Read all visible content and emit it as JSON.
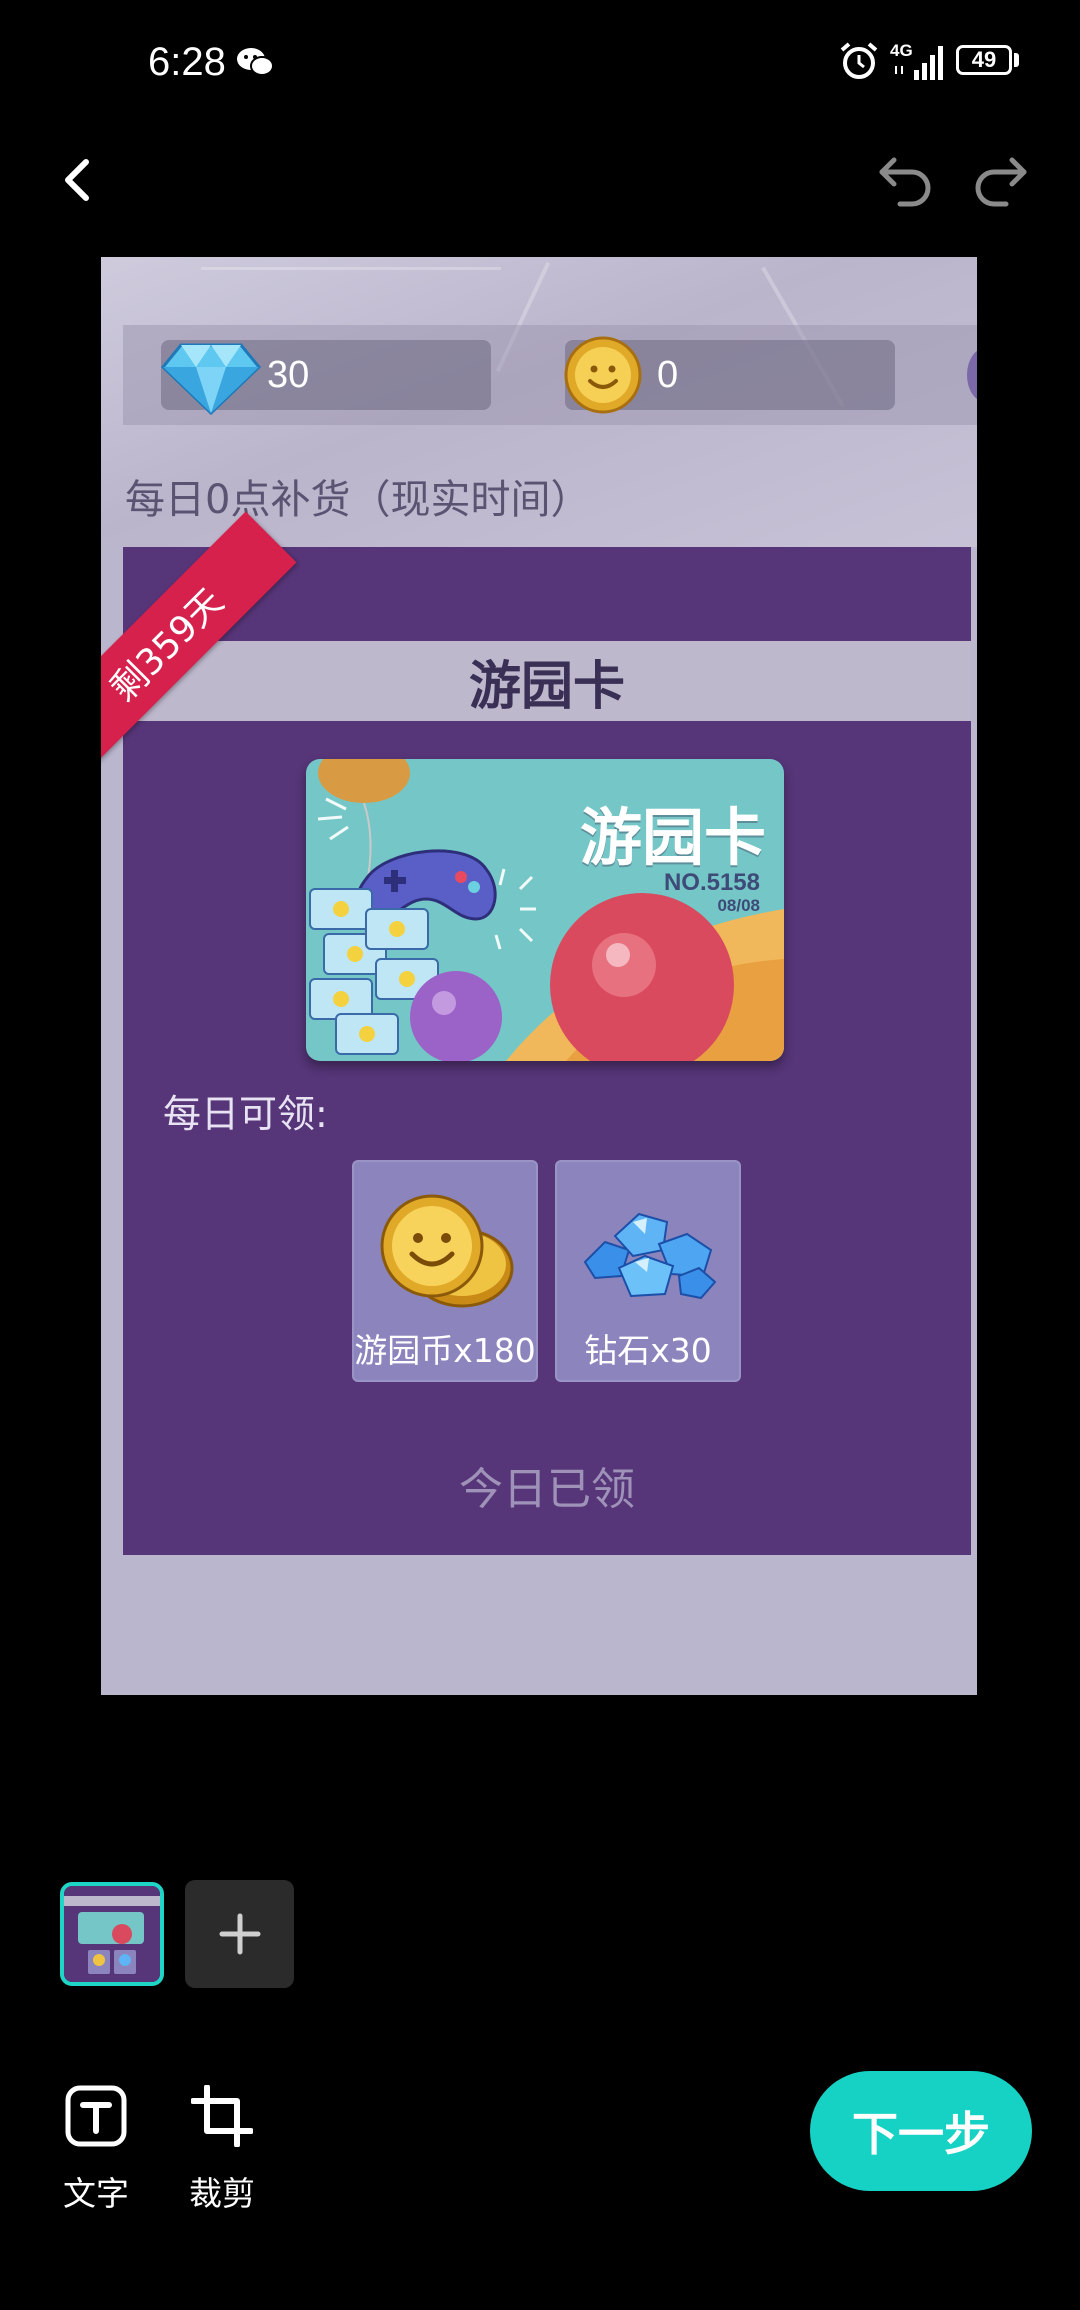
{
  "status_bar": {
    "time": "6:28",
    "network": "4G",
    "battery": "49",
    "icons": [
      "wechat-icon",
      "alarm-icon",
      "signal-icon",
      "battery-icon"
    ]
  },
  "header": {
    "icons": [
      "back-icon",
      "undo-icon",
      "redo-icon"
    ]
  },
  "preview": {
    "currency": [
      {
        "icon": "diamond-icon",
        "value": "30"
      },
      {
        "icon": "coin-icon",
        "value": "0"
      }
    ],
    "restock_note": "每日0点补货（现实时间）",
    "ribbon": "剩359天",
    "title": "游园卡",
    "card": {
      "title": "游园卡",
      "number": "NO.5158",
      "date": "08/08"
    },
    "daily_label": "每日可领:",
    "rewards": [
      {
        "label": "游园币x180",
        "icon": "coin-stack-icon"
      },
      {
        "label": "钻石x30",
        "icon": "diamond-pile-icon"
      }
    ],
    "claim_status": "今日已领"
  },
  "bottom": {
    "tools": [
      {
        "label": "文字",
        "icon": "text-icon"
      },
      {
        "label": "裁剪",
        "icon": "crop-icon"
      }
    ],
    "next_label": "下一步"
  },
  "colors": {
    "accent": "#15d2c4",
    "panel": "#563578",
    "ribbon": "#d6214d"
  }
}
